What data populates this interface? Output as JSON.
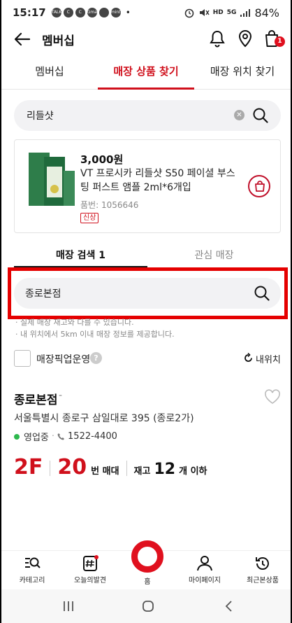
{
  "status_bar": {
    "time": "15:17",
    "notif_icons": [
      "TALK",
      "C",
      "C",
      "Gmail",
      "",
      "mint"
    ],
    "dot": "•",
    "hd_label": "HD",
    "network": "5G",
    "battery": "84%"
  },
  "header": {
    "title": "멤버십",
    "cart_count": "1"
  },
  "tabs": [
    {
      "label": "멤버십"
    },
    {
      "label": "매장 상품 찾기"
    },
    {
      "label": "매장 위치 찾기"
    }
  ],
  "search": {
    "query": "리들샷"
  },
  "product": {
    "price": "3,000원",
    "name": "VT 프로시카 리들샷 S50 페이셜 부스팅 퍼스트 앰플 2ml*6개입",
    "number": "품번: 1056646",
    "tag": "신상"
  },
  "store_tabs": [
    {
      "label": "매장 검색 1"
    },
    {
      "label": "관심 매장"
    }
  ],
  "store_search": {
    "query": "종로본점"
  },
  "notes": [
    "· 실제 매장 재고와 다를 수 있습니다.",
    "· 내 위치에서 5km 이내 매장 정보를 제공합니다."
  ],
  "pickup": {
    "label": "매장픽업운영",
    "help": "?",
    "my_location": "내위치"
  },
  "store": {
    "name": "종로본점",
    "dash": "-",
    "address": "서울특별시 종로구 삼일대로 395 (종로2가)",
    "status": "영업중",
    "phone": "1522-4400",
    "floor": "2F",
    "shelf_no": "20",
    "shelf_label": "번 매대",
    "stock_label": "재고",
    "stock_qty": "12",
    "stock_unit": "개 이하"
  },
  "bottom_nav": [
    {
      "label": "카테고리"
    },
    {
      "label": "오늘의발견"
    },
    {
      "label": "홈"
    },
    {
      "label": "마이페이지"
    },
    {
      "label": "최근본상품"
    }
  ],
  "colors": {
    "accent": "#d0101c",
    "highlight_box": "#e50000",
    "open_dot": "#2db84d"
  }
}
